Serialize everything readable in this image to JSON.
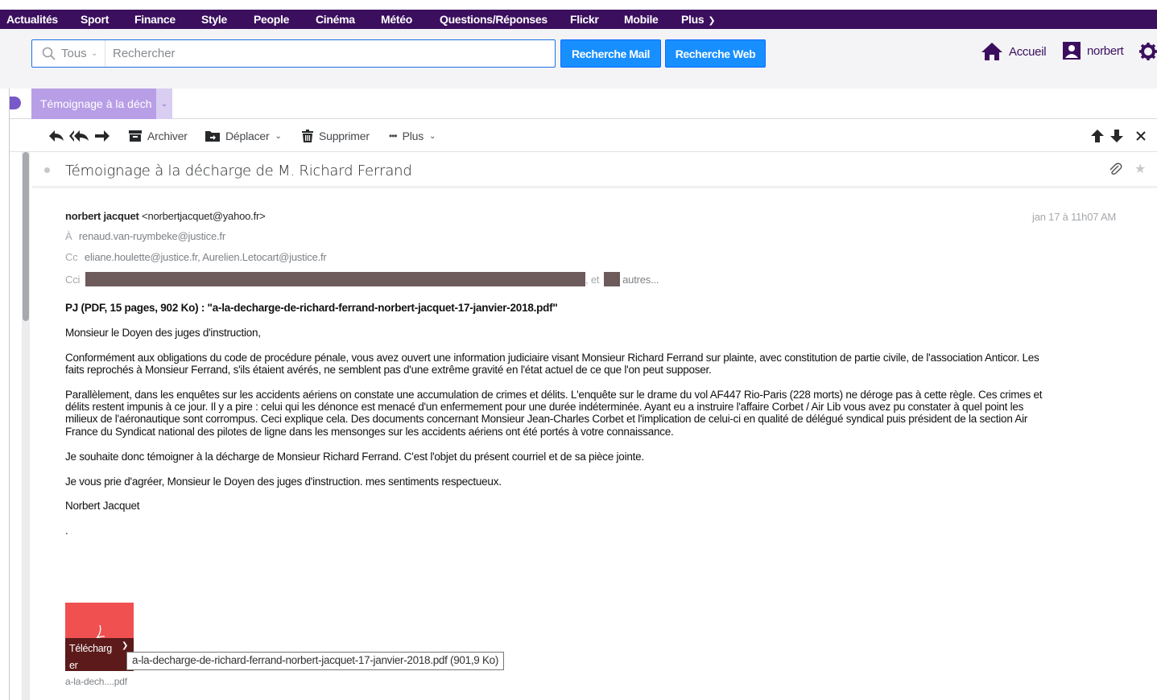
{
  "topnav": {
    "items": [
      "Actualités",
      "Sport",
      "Finance",
      "Style",
      "People",
      "Cinéma",
      "Météo",
      "Questions/Réponses",
      "Flickr",
      "Mobile",
      "Plus"
    ]
  },
  "search": {
    "scope": "Tous",
    "placeholder": "Rechercher",
    "mail_button": "Recherche Mail",
    "web_button": "Recherche Web"
  },
  "header_links": {
    "home": "Accueil",
    "user": "norbert"
  },
  "tab": {
    "label": "Témoignage à la déch"
  },
  "toolbar": {
    "archive": "Archiver",
    "move": "Déplacer",
    "delete": "Supprimer",
    "more": "Plus"
  },
  "message": {
    "subject": "Témoignage à la décharge de M. Richard Ferrand",
    "sender_name": "norbert jacquet",
    "sender_email": "<norbertjacquet@yahoo.fr>",
    "date": "jan 17 à 11h07 AM",
    "to_label": "À",
    "to": "renaud.van-ruymbeke@justice.fr",
    "cc_label": "Cc",
    "cc": "eliane.houlette@justice.fr,  Aurelien.Letocart@justice.fr",
    "bcc_label": "Cci",
    "bcc_sep": ", et",
    "bcc_more": "autres...",
    "attachment_line": "PJ (PDF, 15 pages, 902 Ko) : \"a-la-decharge-de-richard-ferrand-norbert-jacquet-17-janvier-2018.pdf\"",
    "greeting": "Monsieur le Doyen des juges d'instruction,",
    "para1_l1": "Conformément aux obligations du code de procédure pénale, vous avez ouvert une information judiciaire visant Monsieur Richard Ferrand sur plainte, avec constitution de partie civile, de l'association Anticor. Les",
    "para1_l2": "faits reprochés à Monsieur Ferrand, s'ils étaient avérés, ne semblent pas d'une extrême gravité en l'état actuel de ce que l'on peut supposer.",
    "para2_l1": "Parallèlement, dans les enquêtes sur les accidents aériens on constate une accumulation de crimes et délits. L'enquête sur le drame du vol AF447 Rio-Paris (228 morts) ne déroge pas à cette règle. Ces crimes et",
    "para2_l2": "délits restent impunis à ce jour. Il y a pire : celui qui les dénonce est menacé d'un enfermement pour une durée indéterminée. Ayant eu a instruire l'affaire Corbet / Air Lib vous avez pu constater à quel point les",
    "para2_l3": "milieux de l'aéronautique sont corrompus. Ceci explique cela. Des documents concernant Monsieur Jean-Charles Corbet et l'implication de celui-ci en qualité de délégué syndical puis président de la section Air",
    "para2_l4": "France du Syndicat national des pilotes de ligne dans les mensonges sur les accidents aériens ont été portés à votre connaissance.",
    "para3": "Je souhaite donc témoigner à la décharge de Monsieur Richard Ferrand. C'est l'objet du présent courriel et de sa pièce jointe.",
    "para4": "Je vous prie d'agréer, Monsieur le Doyen des juges d'instruction. mes sentiments respectueux.",
    "signature": "Norbert Jacquet",
    "dot": "."
  },
  "attachment": {
    "download_l1": "Télécharg",
    "download_l2": "er",
    "tooltip": "a-la-decharge-de-richard-ferrand-norbert-jacquet-17-janvier-2018.pdf (901,9 Ko)",
    "short_name": "a-la-dech....pdf"
  },
  "colors": {
    "nav_bg": "#3b0f5e",
    "accent_blue": "#188fff",
    "tab_active": "#b89ee6",
    "attachment_bg": "#f05050"
  }
}
